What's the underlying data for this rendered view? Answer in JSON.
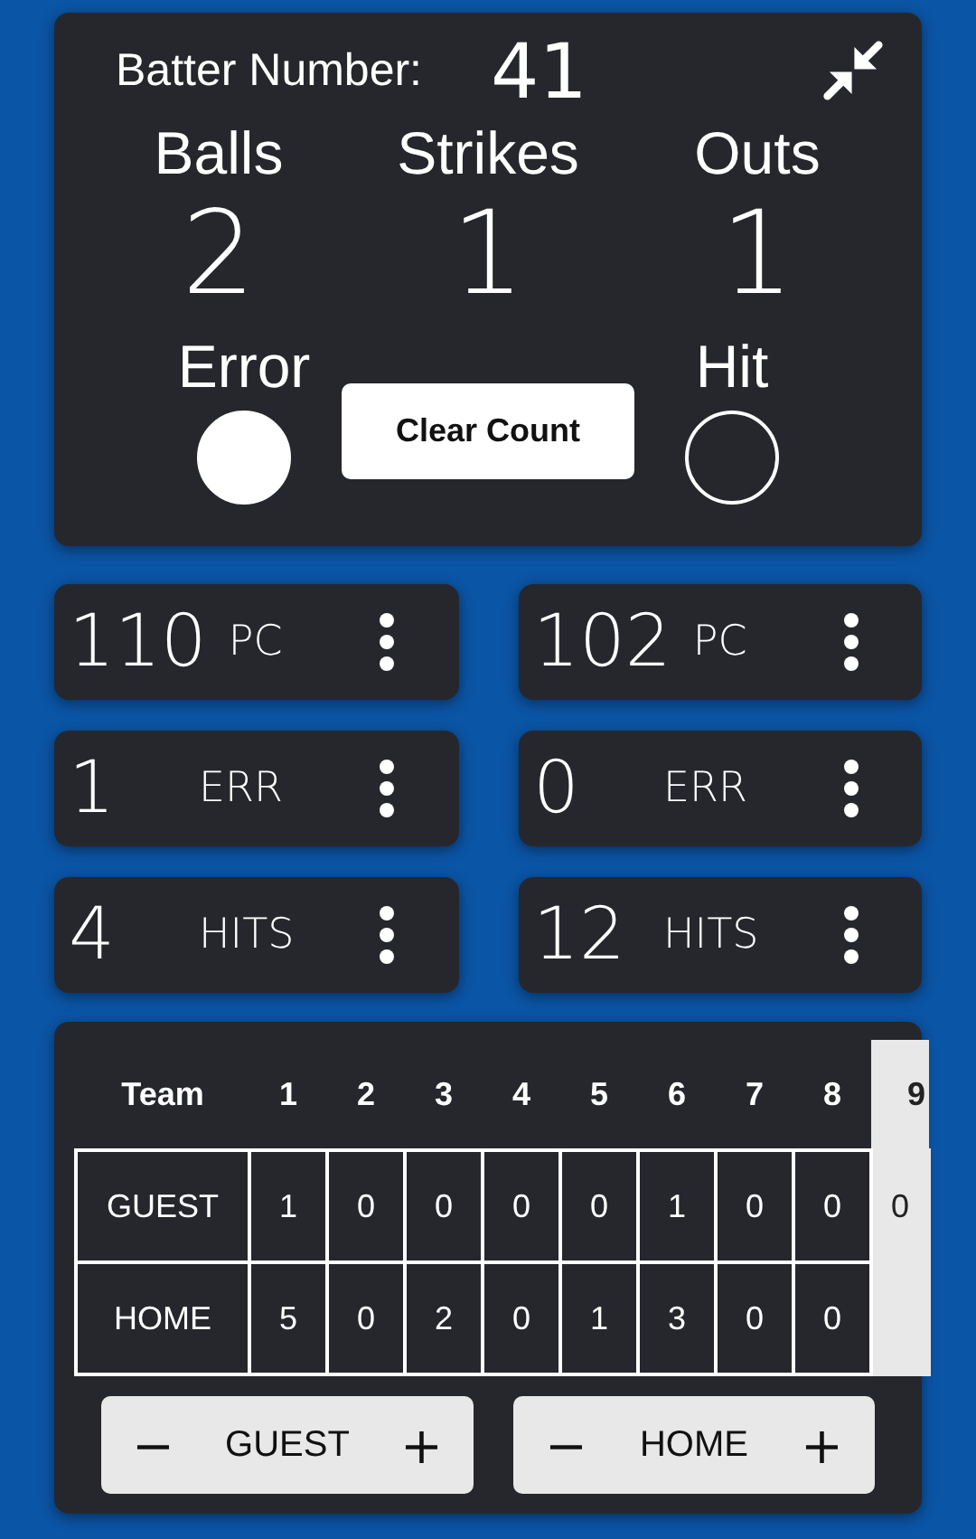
{
  "batter": {
    "label": "Batter Number:",
    "value": "41"
  },
  "count": [
    {
      "label": "Balls",
      "value": "2"
    },
    {
      "label": "Strikes",
      "value": "1"
    },
    {
      "label": "Outs",
      "value": "1"
    }
  ],
  "toggles": [
    {
      "label": "Error",
      "checked": true
    },
    {
      "label": "Hit",
      "checked": false
    }
  ],
  "clear_button": "Clear Count",
  "stats": [
    {
      "value": "110",
      "unit": "PC"
    },
    {
      "value": "102",
      "unit": "PC"
    },
    {
      "value": "1",
      "unit": "ERR"
    },
    {
      "value": "0",
      "unit": "ERR"
    },
    {
      "value": "4",
      "unit": "HITS"
    },
    {
      "value": "12",
      "unit": "HITS"
    }
  ],
  "scoreboard": {
    "team_header": "Team",
    "innings": [
      {
        "label": "1",
        "selected": false
      },
      {
        "label": "2",
        "selected": false
      },
      {
        "label": "3",
        "selected": false
      },
      {
        "label": "4",
        "selected": false
      },
      {
        "label": "5",
        "selected": false
      },
      {
        "label": "6",
        "selected": false
      },
      {
        "label": "7",
        "selected": false
      },
      {
        "label": "8",
        "selected": false
      },
      {
        "label": "9",
        "selected": true
      }
    ],
    "rows": [
      {
        "team": "GUEST",
        "runs": [
          "1",
          "0",
          "0",
          "0",
          "0",
          "1",
          "0",
          "0",
          "0"
        ]
      },
      {
        "team": "HOME",
        "runs": [
          "5",
          "0",
          "2",
          "0",
          "1",
          "3",
          "0",
          "0"
        ]
      }
    ]
  },
  "score_buttons": [
    {
      "minus": "−",
      "label": "GUEST",
      "plus": "+"
    },
    {
      "minus": "−",
      "label": "HOME",
      "plus": "+"
    }
  ]
}
